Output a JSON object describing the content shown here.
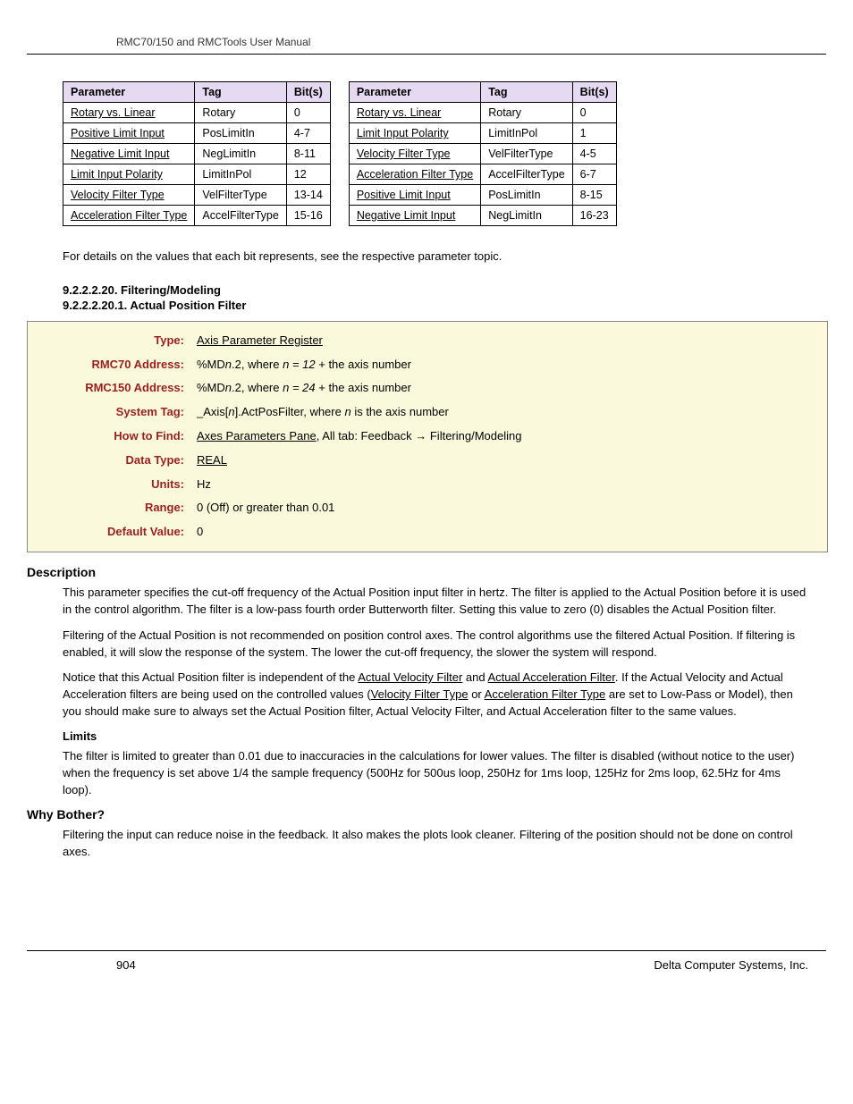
{
  "header": "RMC70/150 and RMCTools User Manual",
  "table_left": {
    "headers": [
      "Parameter",
      "Tag",
      "Bit(s)"
    ],
    "rows": [
      {
        "param": "Rotary vs. Linear",
        "tag": "Rotary",
        "bits": "0"
      },
      {
        "param": "Positive Limit Input",
        "tag": "PosLimitIn",
        "bits": "4-7"
      },
      {
        "param": "Negative Limit Input",
        "tag": "NegLimitIn",
        "bits": "8-11"
      },
      {
        "param": "Limit Input Polarity",
        "tag": "LimitInPol",
        "bits": "12"
      },
      {
        "param": "Velocity Filter Type",
        "tag": "VelFilterType",
        "bits": "13-14"
      },
      {
        "param": "Acceleration Filter Type",
        "tag": "AccelFilterType",
        "bits": "15-16"
      }
    ]
  },
  "table_right": {
    "headers": [
      "Parameter",
      "Tag",
      "Bit(s)"
    ],
    "rows": [
      {
        "param": "Rotary vs. Linear",
        "tag": "Rotary",
        "bits": "0"
      },
      {
        "param": "Limit Input Polarity",
        "tag": "LimitInPol",
        "bits": "1"
      },
      {
        "param": "Velocity Filter Type",
        "tag": "VelFilterType",
        "bits": "4-5"
      },
      {
        "param": "Acceleration Filter Type",
        "tag": "AccelFilterType",
        "bits": "6-7"
      },
      {
        "param": "Positive Limit Input",
        "tag": "PosLimitIn",
        "bits": "8-15"
      },
      {
        "param": "Negative Limit Input",
        "tag": "NegLimitIn",
        "bits": "16-23"
      }
    ]
  },
  "note": "For details on the values that each bit represents, see the respective parameter topic.",
  "section_num": "9.2.2.2.20. Filtering/Modeling",
  "section_sub": "9.2.2.2.20.1. Actual Position Filter",
  "info": {
    "type_label": "Type:",
    "type_value": "Axis Parameter Register",
    "rmc70_label": "RMC70 Address:",
    "rmc70_value_a": "%MD",
    "rmc70_value_b": "n",
    "rmc70_value_c": ".2, where ",
    "rmc70_value_d": "n = 12",
    "rmc70_value_e": " + the axis number",
    "rmc150_label": "RMC150 Address:",
    "rmc150_value_a": "%MD",
    "rmc150_value_b": "n",
    "rmc150_value_c": ".2, where ",
    "rmc150_value_d": "n = 24",
    "rmc150_value_e": " + the axis number",
    "systag_label": "System Tag:",
    "systag_value_a": "_Axis[",
    "systag_value_b": "n",
    "systag_value_c": "].ActPosFilter, where ",
    "systag_value_d": "n",
    "systag_value_e": " is the axis number",
    "howto_label": "How to Find:",
    "howto_link": "Axes Parameters Pane",
    "howto_rest": ", All tab: Feedback → Filtering/Modeling",
    "dtype_label": "Data Type:",
    "dtype_value": "REAL",
    "units_label": "Units:",
    "units_value": "Hz",
    "range_label": "Range:",
    "range_value": "0 (Off) or greater than 0.01",
    "default_label": "Default Value:",
    "default_value": "0"
  },
  "desc_heading": "Description",
  "desc_p1": "This parameter specifies the cut-off frequency of the Actual Position input filter in hertz. The filter is applied to the Actual Position before it is used in the control algorithm. The filter is a low-pass fourth order Butterworth filter. Setting this value to zero (0) disables the Actual Position filter.",
  "desc_p2": "Filtering of the Actual Position is not recommended on position control axes. The control algorithms use the filtered Actual Position. If filtering is enabled, it will slow the response of the system. The lower the cut-off frequency, the slower the system will respond.",
  "desc_p3_a": "Notice that this Actual Position filter is independent of the ",
  "desc_p3_link1": "Actual Velocity Filter",
  "desc_p3_b": " and ",
  "desc_p3_link2": "Actual Acceleration Filter",
  "desc_p3_c": ". If the Actual Velocity and Actual Acceleration filters are being used on the controlled values (",
  "desc_p3_link3": "Velocity Filter Type",
  "desc_p3_d": " or ",
  "desc_p3_link4": "Acceleration Filter Type",
  "desc_p3_e": " are set to Low-Pass or Model), then you should make sure to always set the Actual Position filter, Actual Velocity Filter, and Actual Acceleration filter to the same values.",
  "limits_heading": "Limits",
  "limits_p": "The filter is limited to greater than 0.01 due to inaccuracies in the calculations for lower values. The filter is disabled (without notice to the user) when the frequency is set above 1/4 the sample frequency (500Hz for 500us loop, 250Hz for 1ms loop, 125Hz for 2ms loop, 62.5Hz for 4ms loop).",
  "why_heading": "Why Bother?",
  "why_p": "Filtering the input can reduce noise in the feedback. It also makes the plots look cleaner. Filtering of the position should not be done on control axes.",
  "footer_page": "904",
  "footer_company": "Delta Computer Systems, Inc."
}
